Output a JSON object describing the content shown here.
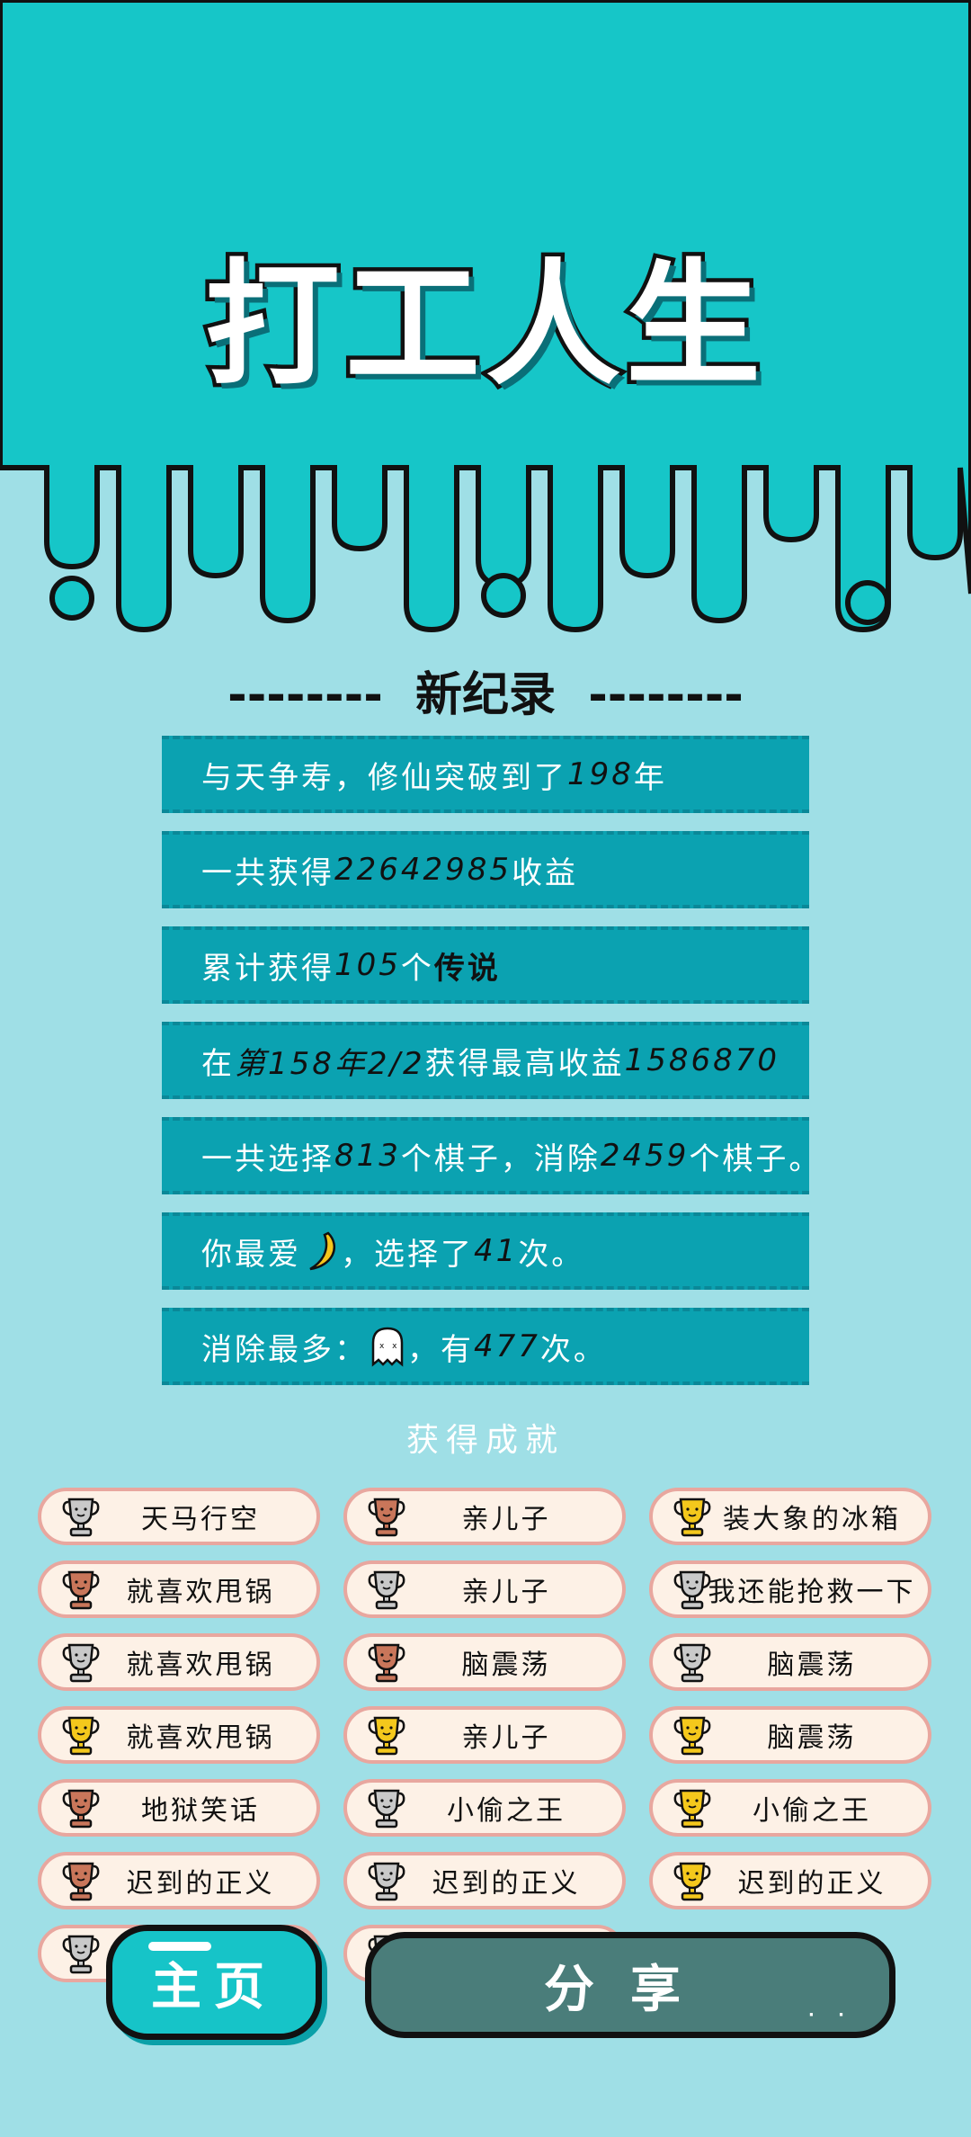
{
  "app": {
    "title": "打工人生",
    "colors": {
      "header": "#16c6c8",
      "background": "#9fdfe6",
      "record_row": "#0ba2b1",
      "pill_bg": "#fdf1e6",
      "pill_border": "#e8a79f"
    }
  },
  "records": {
    "heading": "--------  新纪录  --------",
    "rows": [
      [
        {
          "t": "与天争寿，修仙突破到了"
        },
        {
          "t": "198",
          "c": "num"
        },
        {
          "t": "年"
        }
      ],
      [
        {
          "t": "一共获得"
        },
        {
          "t": "22642985",
          "c": "num"
        },
        {
          "t": "收益"
        }
      ],
      [
        {
          "t": "累计获得"
        },
        {
          "t": "105",
          "c": "num"
        },
        {
          "t": "个 "
        },
        {
          "t": "传说",
          "c": "bold-black"
        }
      ],
      [
        {
          "t": "在 "
        },
        {
          "t": "第158年2/2",
          "c": "num"
        },
        {
          "t": " 获得最高收益"
        },
        {
          "t": "1586870",
          "c": "num"
        }
      ],
      [
        {
          "t": "一共选择"
        },
        {
          "t": "813",
          "c": "num"
        },
        {
          "t": "个棋子，消除"
        },
        {
          "t": "2459",
          "c": "num"
        },
        {
          "t": "个棋子。"
        }
      ],
      [
        {
          "t": "你最爱"
        },
        {
          "icon": "banana-icon"
        },
        {
          "t": "，选择了"
        },
        {
          "t": "41",
          "c": "num"
        },
        {
          "t": "次。"
        }
      ],
      [
        {
          "t": "消除最多："
        },
        {
          "icon": "ghost-icon"
        },
        {
          "t": "，有"
        },
        {
          "t": "477",
          "c": "num"
        },
        {
          "t": "次。"
        }
      ]
    ]
  },
  "achievements": {
    "heading": "获得成就",
    "items": [
      {
        "label": "天马行空",
        "trophy": "silver"
      },
      {
        "label": "亲儿子",
        "trophy": "bronze"
      },
      {
        "label": "装大象的冰箱",
        "trophy": "gold"
      },
      {
        "label": "就喜欢甩锅",
        "trophy": "bronze"
      },
      {
        "label": "亲儿子",
        "trophy": "silver"
      },
      {
        "label": "我还能抢救一下",
        "trophy": "silver"
      },
      {
        "label": "就喜欢甩锅",
        "trophy": "silver"
      },
      {
        "label": "脑震荡",
        "trophy": "bronze"
      },
      {
        "label": "脑震荡",
        "trophy": "silver"
      },
      {
        "label": "就喜欢甩锅",
        "trophy": "gold"
      },
      {
        "label": "亲儿子",
        "trophy": "gold"
      },
      {
        "label": "脑震荡",
        "trophy": "gold"
      },
      {
        "label": "地狱笑话",
        "trophy": "bronze"
      },
      {
        "label": "小偷之王",
        "trophy": "silver"
      },
      {
        "label": "小偷之王",
        "trophy": "gold"
      },
      {
        "label": "迟到的正义",
        "trophy": "bronze"
      },
      {
        "label": "迟到的正义",
        "trophy": "silver"
      },
      {
        "label": "迟到的正义",
        "trophy": "gold"
      },
      {
        "label": "",
        "trophy": "silver"
      },
      {
        "label": "",
        "trophy": "silver"
      }
    ]
  },
  "buttons": {
    "home": "主页",
    "share": "分享"
  }
}
